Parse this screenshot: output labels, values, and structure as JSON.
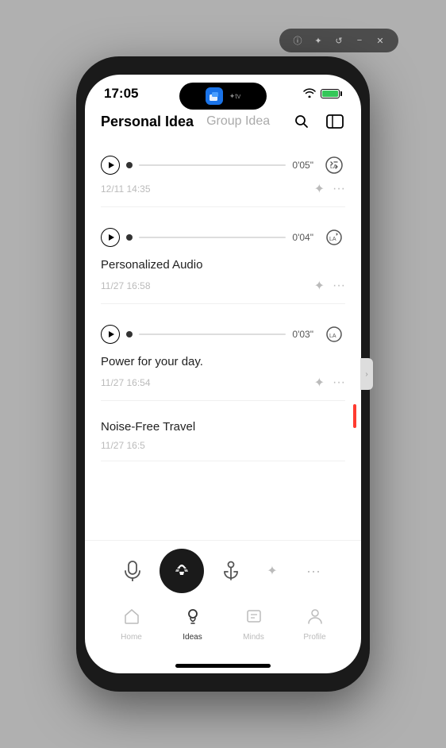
{
  "window": {
    "chrome_buttons": [
      "info",
      "star",
      "refresh",
      "minimize",
      "close"
    ]
  },
  "status_bar": {
    "time": "17:05",
    "tv_label": "✦tv",
    "battery_pct": "98%"
  },
  "tabs": {
    "personal_label": "Personal Idea",
    "group_label": "Group Idea"
  },
  "cards": [
    {
      "id": "card1",
      "duration": "0'05\"",
      "title": "",
      "date": "12/11 14:35"
    },
    {
      "id": "card2",
      "duration": "0'04\"",
      "title": "Personalized Audio",
      "date": "11/27 16:58"
    },
    {
      "id": "card3",
      "duration": "0'03\"",
      "title": "Power for your day.",
      "date": "11/27 16:54"
    },
    {
      "id": "card4",
      "duration": "",
      "title": "Noise-Free Travel",
      "date": "11/27 16:5"
    }
  ],
  "toolbar": {
    "mic_label": "microphone",
    "record_label": "record",
    "anchor_label": "anchor"
  },
  "bottom_nav": {
    "items": [
      {
        "id": "home",
        "label": "Home",
        "active": false
      },
      {
        "id": "ideas",
        "label": "Ideas",
        "active": true
      },
      {
        "id": "minds",
        "label": "Minds",
        "active": false
      },
      {
        "id": "profile",
        "label": "Profile",
        "active": false
      }
    ]
  }
}
